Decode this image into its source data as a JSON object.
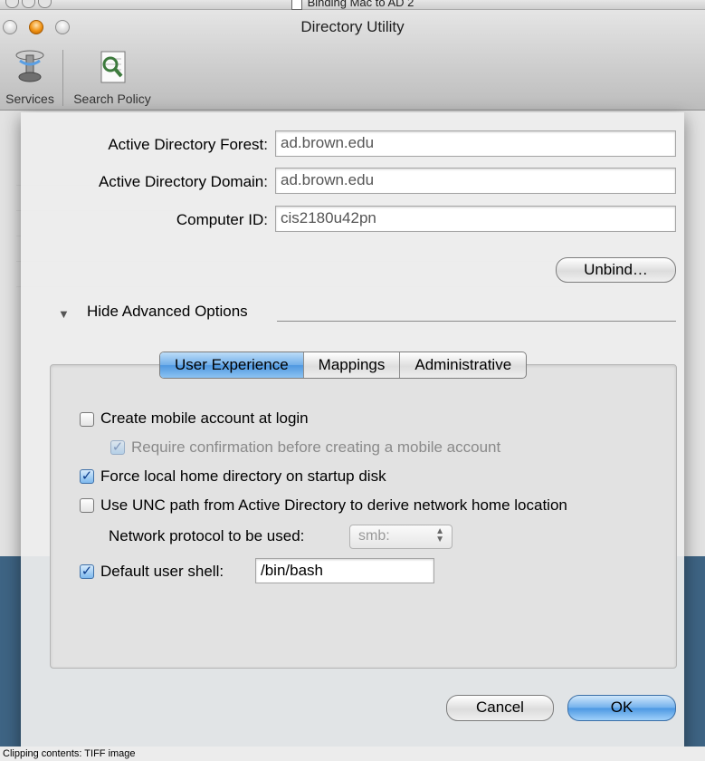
{
  "outer_window": {
    "title": "Binding Mac to AD 2"
  },
  "window": {
    "title": "Directory Utility",
    "toolbar": [
      {
        "label": "Services",
        "icon": "services-icon"
      },
      {
        "label": "Search Policy",
        "icon": "search-policy-icon"
      }
    ]
  },
  "sheet": {
    "forest_label": "Active Directory Forest:",
    "forest_value": "ad.brown.edu",
    "domain_label": "Active Directory Domain:",
    "domain_value": "ad.brown.edu",
    "computer_id_label": "Computer ID:",
    "computer_id_value": "cis2180u42pn",
    "unbind_label": "Unbind…",
    "advanced_toggle": "Hide Advanced Options",
    "tabs": [
      "User Experience",
      "Mappings",
      "Administrative"
    ],
    "selected_tab": "User Experience",
    "options": {
      "mobile_account": {
        "label": "Create mobile account at login",
        "checked": false
      },
      "require_confirmation": {
        "label": "Require confirmation before creating a mobile account",
        "checked": true,
        "enabled": false
      },
      "force_local_home": {
        "label": "Force local home directory on startup disk",
        "checked": true
      },
      "use_unc": {
        "label": "Use UNC path from Active Directory to derive network home location",
        "checked": false
      },
      "protocol_label": "Network protocol to be used:",
      "protocol_value": "smb:",
      "default_shell": {
        "label": "Default user shell:",
        "checked": true,
        "value": "/bin/bash"
      }
    },
    "cancel_label": "Cancel",
    "ok_label": "OK"
  },
  "status_bar": "Clipping contents: TIFF image",
  "colors": {
    "accent_blue": "#5a9fe4",
    "desktop": "#3e6484"
  }
}
